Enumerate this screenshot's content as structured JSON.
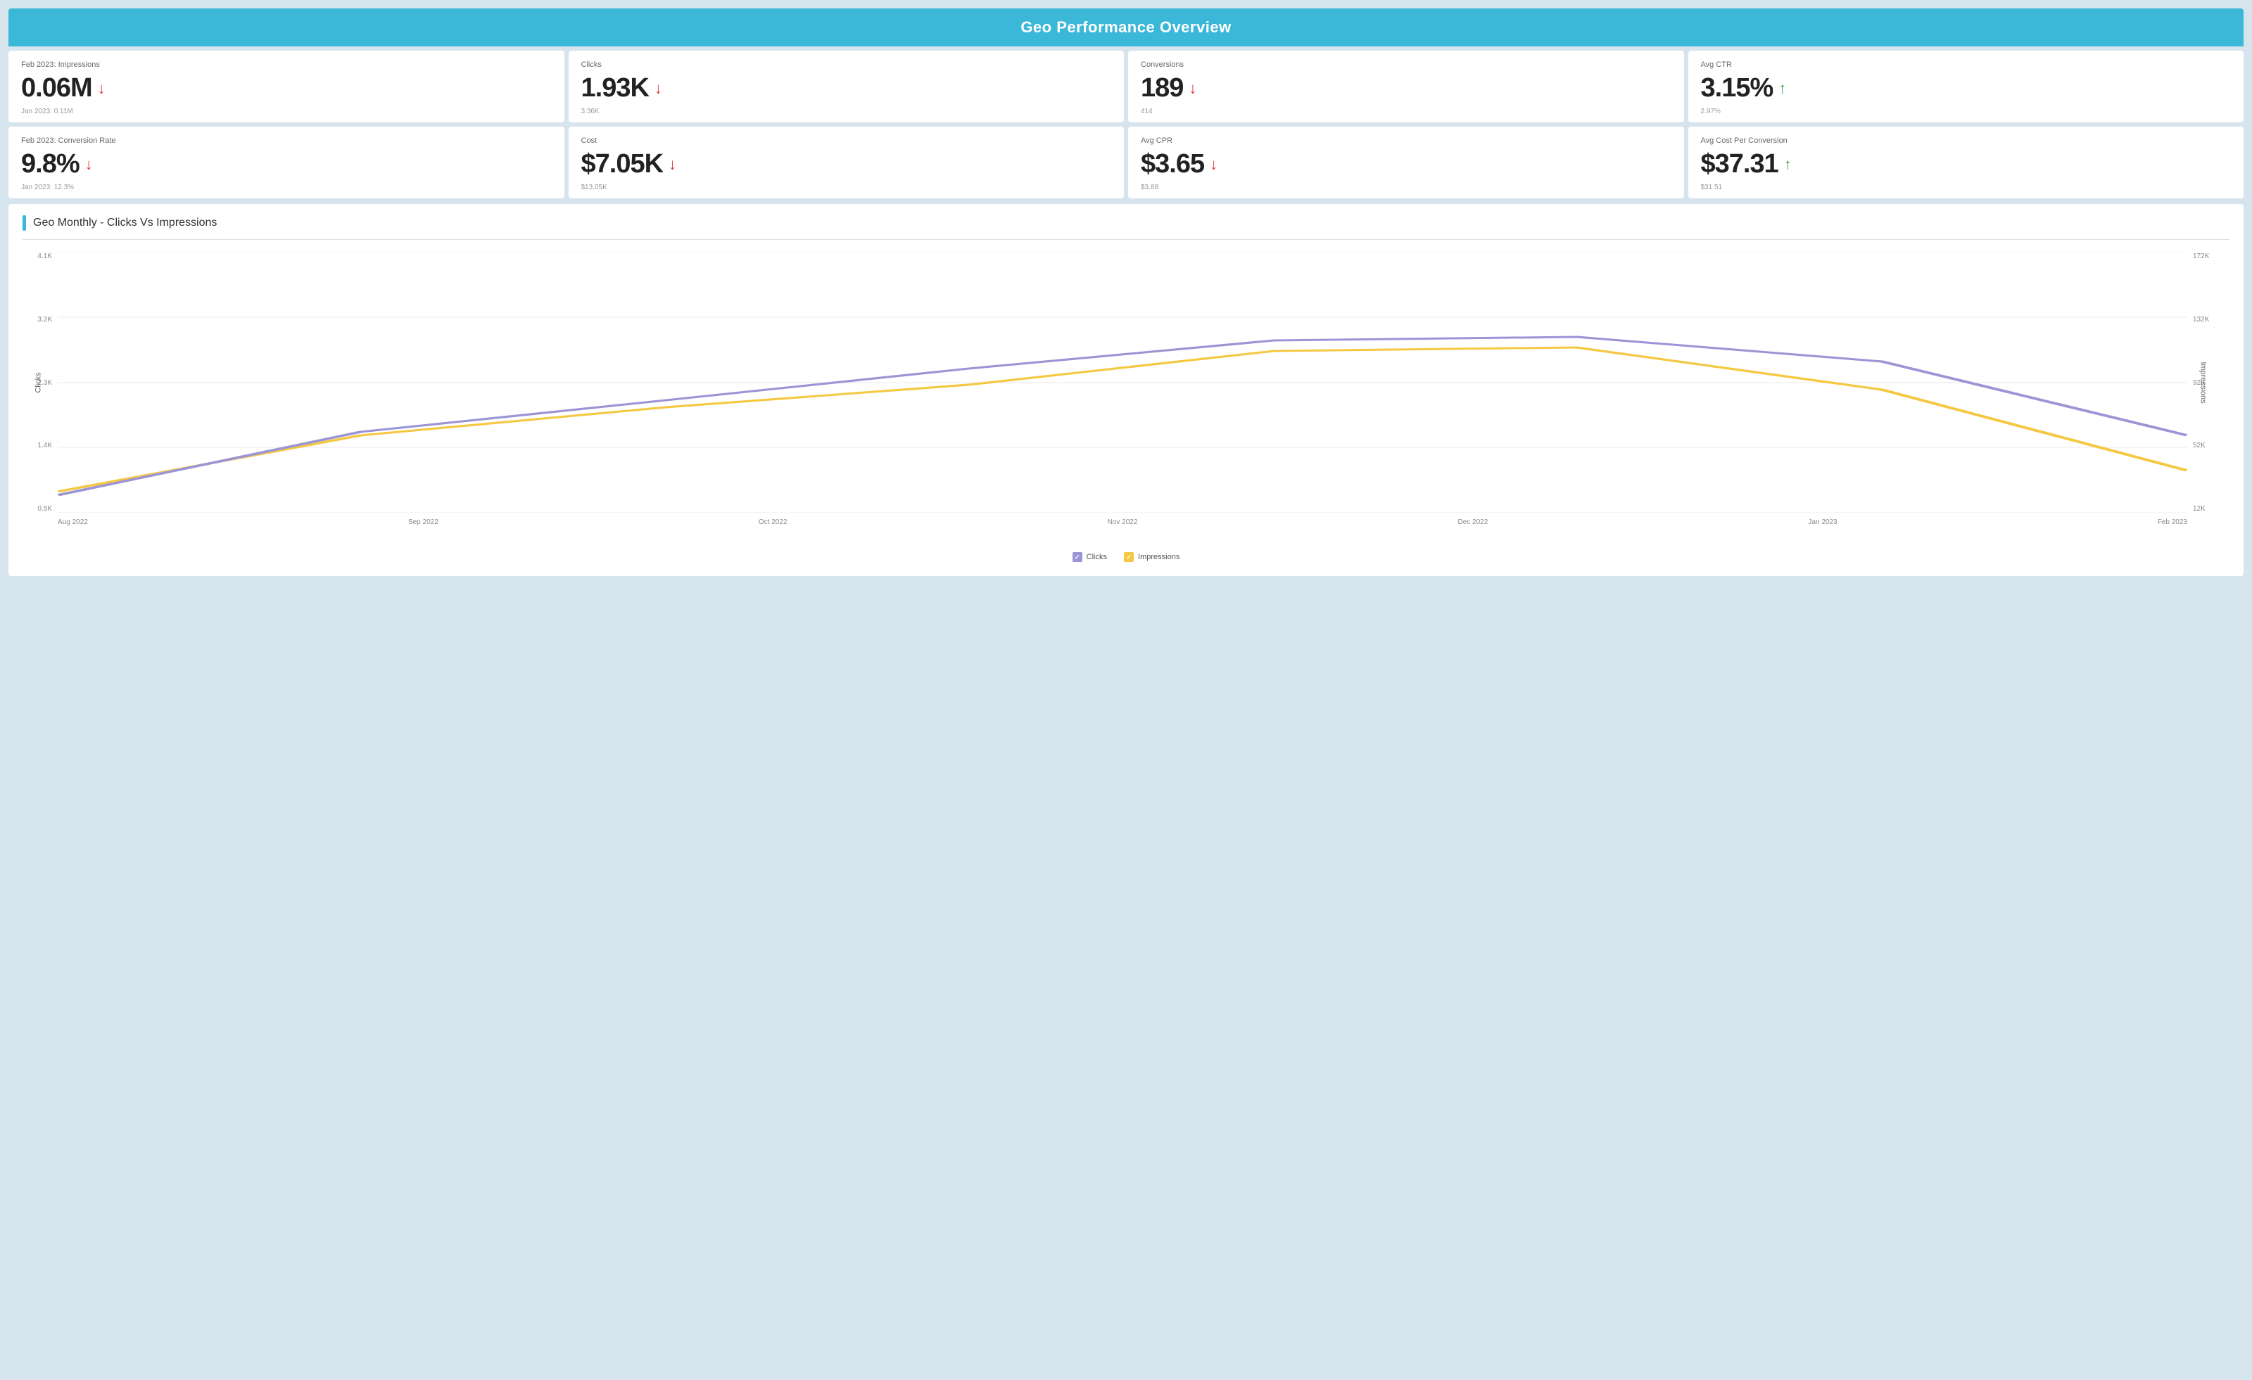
{
  "header": {
    "title": "Geo Performance Overview"
  },
  "metrics_row1": [
    {
      "id": "impressions",
      "label": "Feb 2023: Impressions",
      "value": "0.06M",
      "direction": "down",
      "sub": "Jan 2023: 0.11M"
    },
    {
      "id": "clicks",
      "label": "Clicks",
      "value": "1.93K",
      "direction": "down",
      "sub": "3.36K"
    },
    {
      "id": "conversions",
      "label": "Conversions",
      "value": "189",
      "direction": "down",
      "sub": "414"
    },
    {
      "id": "avg_ctr",
      "label": "Avg CTR",
      "value": "3.15%",
      "direction": "up",
      "sub": "2.97%"
    }
  ],
  "metrics_row2": [
    {
      "id": "conversion_rate",
      "label": "Feb 2023: Conversion Rate",
      "value": "9.8%",
      "direction": "down",
      "sub": "Jan 2023: 12.3%"
    },
    {
      "id": "cost",
      "label": "Cost",
      "value": "$7.05K",
      "direction": "down",
      "sub": "$13.05K"
    },
    {
      "id": "avg_cpr",
      "label": "Avg CPR",
      "value": "$3.65",
      "direction": "down",
      "sub": "$3.88"
    },
    {
      "id": "avg_cost_per_conversion",
      "label": "Avg Cost Per Conversion",
      "value": "$37.31",
      "direction": "up",
      "sub": "$31.51"
    }
  ],
  "chart": {
    "title": "Geo Monthly - Clicks Vs Impressions",
    "y_left_labels": [
      "4.1K",
      "3.2K",
      "2.3K",
      "1.4K",
      "0.5K"
    ],
    "y_right_labels": [
      "172K",
      "132K",
      "92K",
      "52K",
      "12K"
    ],
    "x_labels": [
      "Aug 2022",
      "Sep 2022",
      "Oct 2022",
      "Nov 2022",
      "Dec 2022",
      "Jan 2023",
      "Feb 2023"
    ],
    "y_left_title": "Clicks",
    "y_right_title": "Impressions",
    "legend": {
      "clicks_label": "Clicks",
      "impressions_label": "Impressions"
    }
  }
}
